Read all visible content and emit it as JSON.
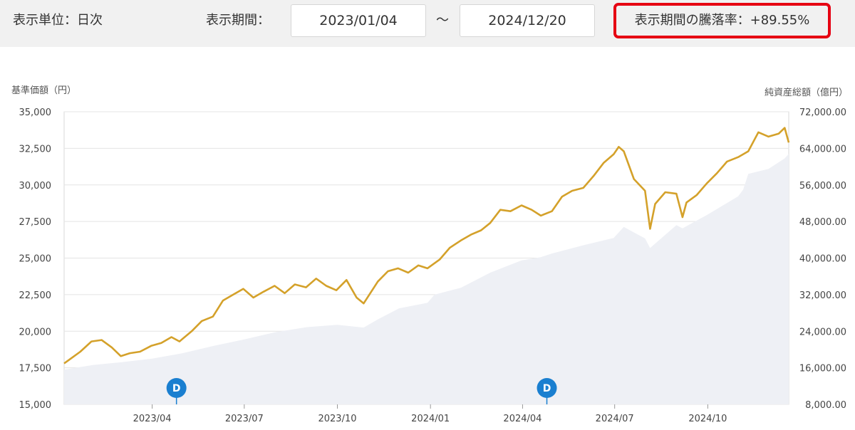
{
  "header": {
    "unit_label": "表示単位：日次",
    "period_label": "表示期間：",
    "start_date": "2023/01/04",
    "separator": "～",
    "end_date": "2024/12/20",
    "change_label": "表示期間の騰落率：+89.55%"
  },
  "colors": {
    "nav_line": "#d4a12a",
    "assets_area": "#eef0f5",
    "highlight_border": "#e60012",
    "dividend_marker": "#1a7fd0"
  },
  "chart_data": {
    "type": "line",
    "left_axis": {
      "title": "基準価額（円）",
      "range": [
        15000,
        35000
      ],
      "ticks": [
        "15,000",
        "17,500",
        "20,000",
        "22,500",
        "25,000",
        "27,500",
        "30,000",
        "32,500",
        "35,000"
      ]
    },
    "right_axis": {
      "title": "純資産総額（億円）",
      "range": [
        8000,
        72000
      ],
      "ticks": [
        "8,000.00",
        "16,000.00",
        "24,000.00",
        "32,000.00",
        "40,000.00",
        "48,000.00",
        "56,000.00",
        "64,000.00",
        "72,000.00"
      ]
    },
    "x_axis": {
      "range": [
        "2023-01-04",
        "2024-12-20"
      ],
      "ticks": [
        {
          "date": "2023-04-01",
          "label": "2023/04"
        },
        {
          "date": "2023-07-01",
          "label": "2023/07"
        },
        {
          "date": "2023-10-01",
          "label": "2023/10"
        },
        {
          "date": "2024-01-01",
          "label": "2024/01"
        },
        {
          "date": "2024-04-01",
          "label": "2024/04"
        },
        {
          "date": "2024-07-01",
          "label": "2024/07"
        },
        {
          "date": "2024-10-01",
          "label": "2024/10"
        }
      ]
    },
    "grid": "horizontal",
    "dividend_markers": [
      {
        "date": "2023-04-25",
        "label": "D"
      },
      {
        "date": "2024-04-25",
        "label": "D"
      }
    ],
    "series": [
      {
        "axis": "left",
        "style": "line",
        "x": [
          "2023-01-04",
          "2023-01-10",
          "2023-01-20",
          "2023-01-31",
          "2023-02-10",
          "2023-02-20",
          "2023-03-01",
          "2023-03-10",
          "2023-03-20",
          "2023-03-31",
          "2023-04-10",
          "2023-04-20",
          "2023-04-28",
          "2023-05-10",
          "2023-05-20",
          "2023-05-31",
          "2023-06-10",
          "2023-06-20",
          "2023-06-30",
          "2023-07-10",
          "2023-07-20",
          "2023-07-31",
          "2023-08-10",
          "2023-08-20",
          "2023-08-31",
          "2023-09-10",
          "2023-09-20",
          "2023-09-30",
          "2023-10-10",
          "2023-10-20",
          "2023-10-27",
          "2023-11-10",
          "2023-11-20",
          "2023-11-30",
          "2023-12-10",
          "2023-12-20",
          "2023-12-29",
          "2024-01-10",
          "2024-01-20",
          "2024-01-31",
          "2024-02-10",
          "2024-02-20",
          "2024-02-29",
          "2024-03-10",
          "2024-03-20",
          "2024-03-31",
          "2024-04-10",
          "2024-04-19",
          "2024-04-30",
          "2024-05-10",
          "2024-05-20",
          "2024-05-31",
          "2024-06-10",
          "2024-06-20",
          "2024-06-30",
          "2024-07-05",
          "2024-07-10",
          "2024-07-20",
          "2024-07-31",
          "2024-08-05",
          "2024-08-10",
          "2024-08-20",
          "2024-08-31",
          "2024-09-06",
          "2024-09-10",
          "2024-09-20",
          "2024-09-30",
          "2024-10-10",
          "2024-10-20",
          "2024-10-31",
          "2024-11-05",
          "2024-11-10",
          "2024-11-20",
          "2024-11-30",
          "2024-12-10",
          "2024-12-16",
          "2024-12-20"
        ],
        "values": [
          17800,
          18100,
          18600,
          19300,
          19400,
          18900,
          18300,
          18500,
          18600,
          19000,
          19200,
          19600,
          19300,
          20000,
          20700,
          21000,
          22100,
          22500,
          22900,
          22300,
          22700,
          23100,
          22600,
          23200,
          23000,
          23600,
          23100,
          22800,
          23500,
          22300,
          21900,
          23400,
          24100,
          24300,
          24000,
          24500,
          24300,
          24900,
          25700,
          26200,
          26600,
          26900,
          27400,
          28300,
          28200,
          28600,
          28300,
          27900,
          28200,
          29200,
          29600,
          29800,
          30600,
          31500,
          32100,
          32600,
          32300,
          30400,
          29600,
          27000,
          28700,
          29500,
          29400,
          27800,
          28800,
          29300,
          30100,
          30800,
          31600,
          31900,
          32100,
          32300,
          33600,
          33300,
          33500,
          33900,
          32900
        ]
      },
      {
        "axis": "right",
        "style": "area",
        "x": [
          "2023-01-04",
          "2023-02-01",
          "2023-03-01",
          "2023-04-01",
          "2023-05-01",
          "2023-06-01",
          "2023-07-01",
          "2023-08-01",
          "2023-09-01",
          "2023-10-01",
          "2023-10-27",
          "2023-11-10",
          "2023-12-01",
          "2023-12-29",
          "2024-01-05",
          "2024-01-31",
          "2024-02-29",
          "2024-03-31",
          "2024-04-19",
          "2024-04-30",
          "2024-05-31",
          "2024-06-30",
          "2024-07-10",
          "2024-07-31",
          "2024-08-05",
          "2024-08-31",
          "2024-09-06",
          "2024-09-30",
          "2024-10-31",
          "2024-11-05",
          "2024-11-10",
          "2024-11-30",
          "2024-12-16",
          "2024-12-20"
        ],
        "values": [
          15600,
          16600,
          17200,
          18000,
          19200,
          20800,
          22200,
          23800,
          24900,
          25400,
          24800,
          26600,
          29000,
          30200,
          32000,
          33500,
          36800,
          39500,
          40200,
          41000,
          42800,
          44400,
          46800,
          44300,
          42200,
          47200,
          46500,
          49400,
          53500,
          55000,
          58400,
          59500,
          61800,
          62800
        ]
      }
    ]
  }
}
